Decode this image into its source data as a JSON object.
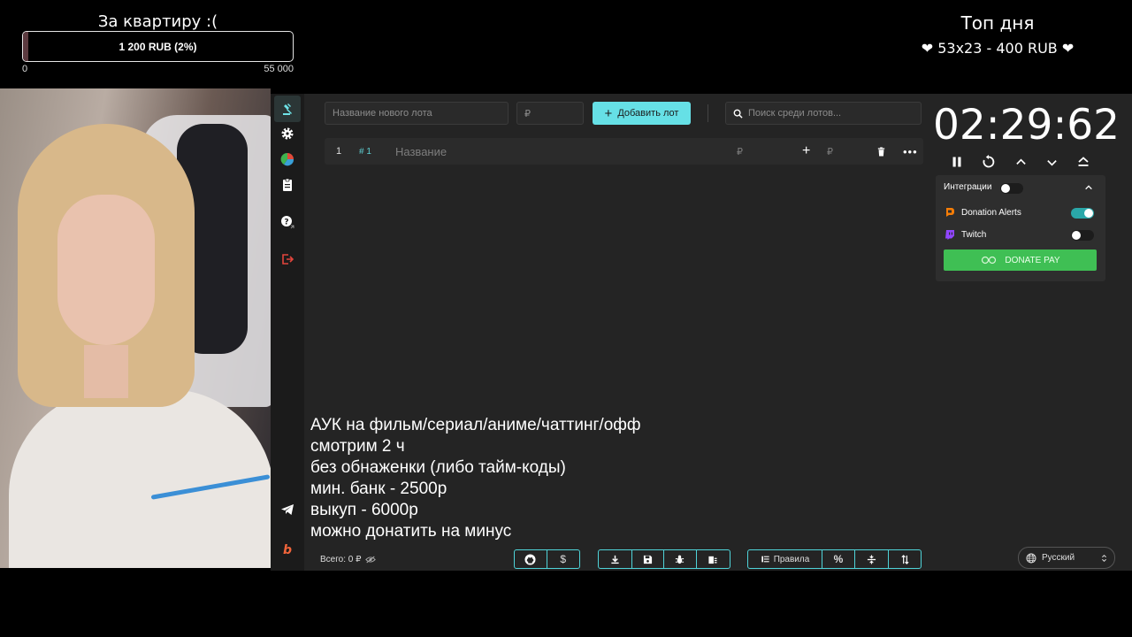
{
  "goal": {
    "title": "За квартиру :(",
    "progress_text": "1 200 RUB (2%)",
    "progress_fraction": 0.02,
    "min_label": "0",
    "max_label": "55 000",
    "fill_color": "#5b3a3f"
  },
  "top_day": {
    "title": "Топ дня",
    "line": "53x23 - 400 RUB"
  },
  "sidebar": {
    "items": [
      {
        "icon": "gavel-icon",
        "active": true
      },
      {
        "icon": "gear-icon"
      },
      {
        "icon": "pie-chart-icon"
      },
      {
        "icon": "clipboard-icon"
      },
      {
        "icon": "help-icon"
      },
      {
        "icon": "logout-icon"
      },
      {
        "icon": "telegram-icon"
      },
      {
        "icon": "brand-b-icon"
      }
    ]
  },
  "toolbar": {
    "new_lot_placeholder": "Название нового лота",
    "amount_placeholder": "₽",
    "add_lot_label": "Добавить лот",
    "search_placeholder": "Поиск среди лотов...",
    "accent_color": "#66e0e6"
  },
  "lot": {
    "index": "1",
    "tag": "# 1",
    "name_placeholder": "Название",
    "amount_placeholder": "₽",
    "add_amount_placeholder": "₽"
  },
  "timer": {
    "display": "02:29:62"
  },
  "integrations": {
    "title": "Интеграции",
    "items": [
      {
        "name": "Donation Alerts",
        "enabled": true
      },
      {
        "name": "Twitch",
        "enabled": false
      }
    ],
    "donate_pay_label": "DONATE PAY",
    "toggle_on_color": "#2aa7a8",
    "donate_pay_color": "#3fbf54"
  },
  "rules": {
    "lines": [
      "АУК на фильм/сериал/аниме/чаттинг/офф",
      "смотрим 2 ч",
      "без обнаженки (либо тайм-коды)",
      "мин. банк - 2500р",
      "выкуп - 6000р",
      "можно донатить на минус"
    ]
  },
  "footer": {
    "total_label": "Всего: 0 ₽",
    "rules_button_label": "Правила",
    "language": "Русский"
  }
}
